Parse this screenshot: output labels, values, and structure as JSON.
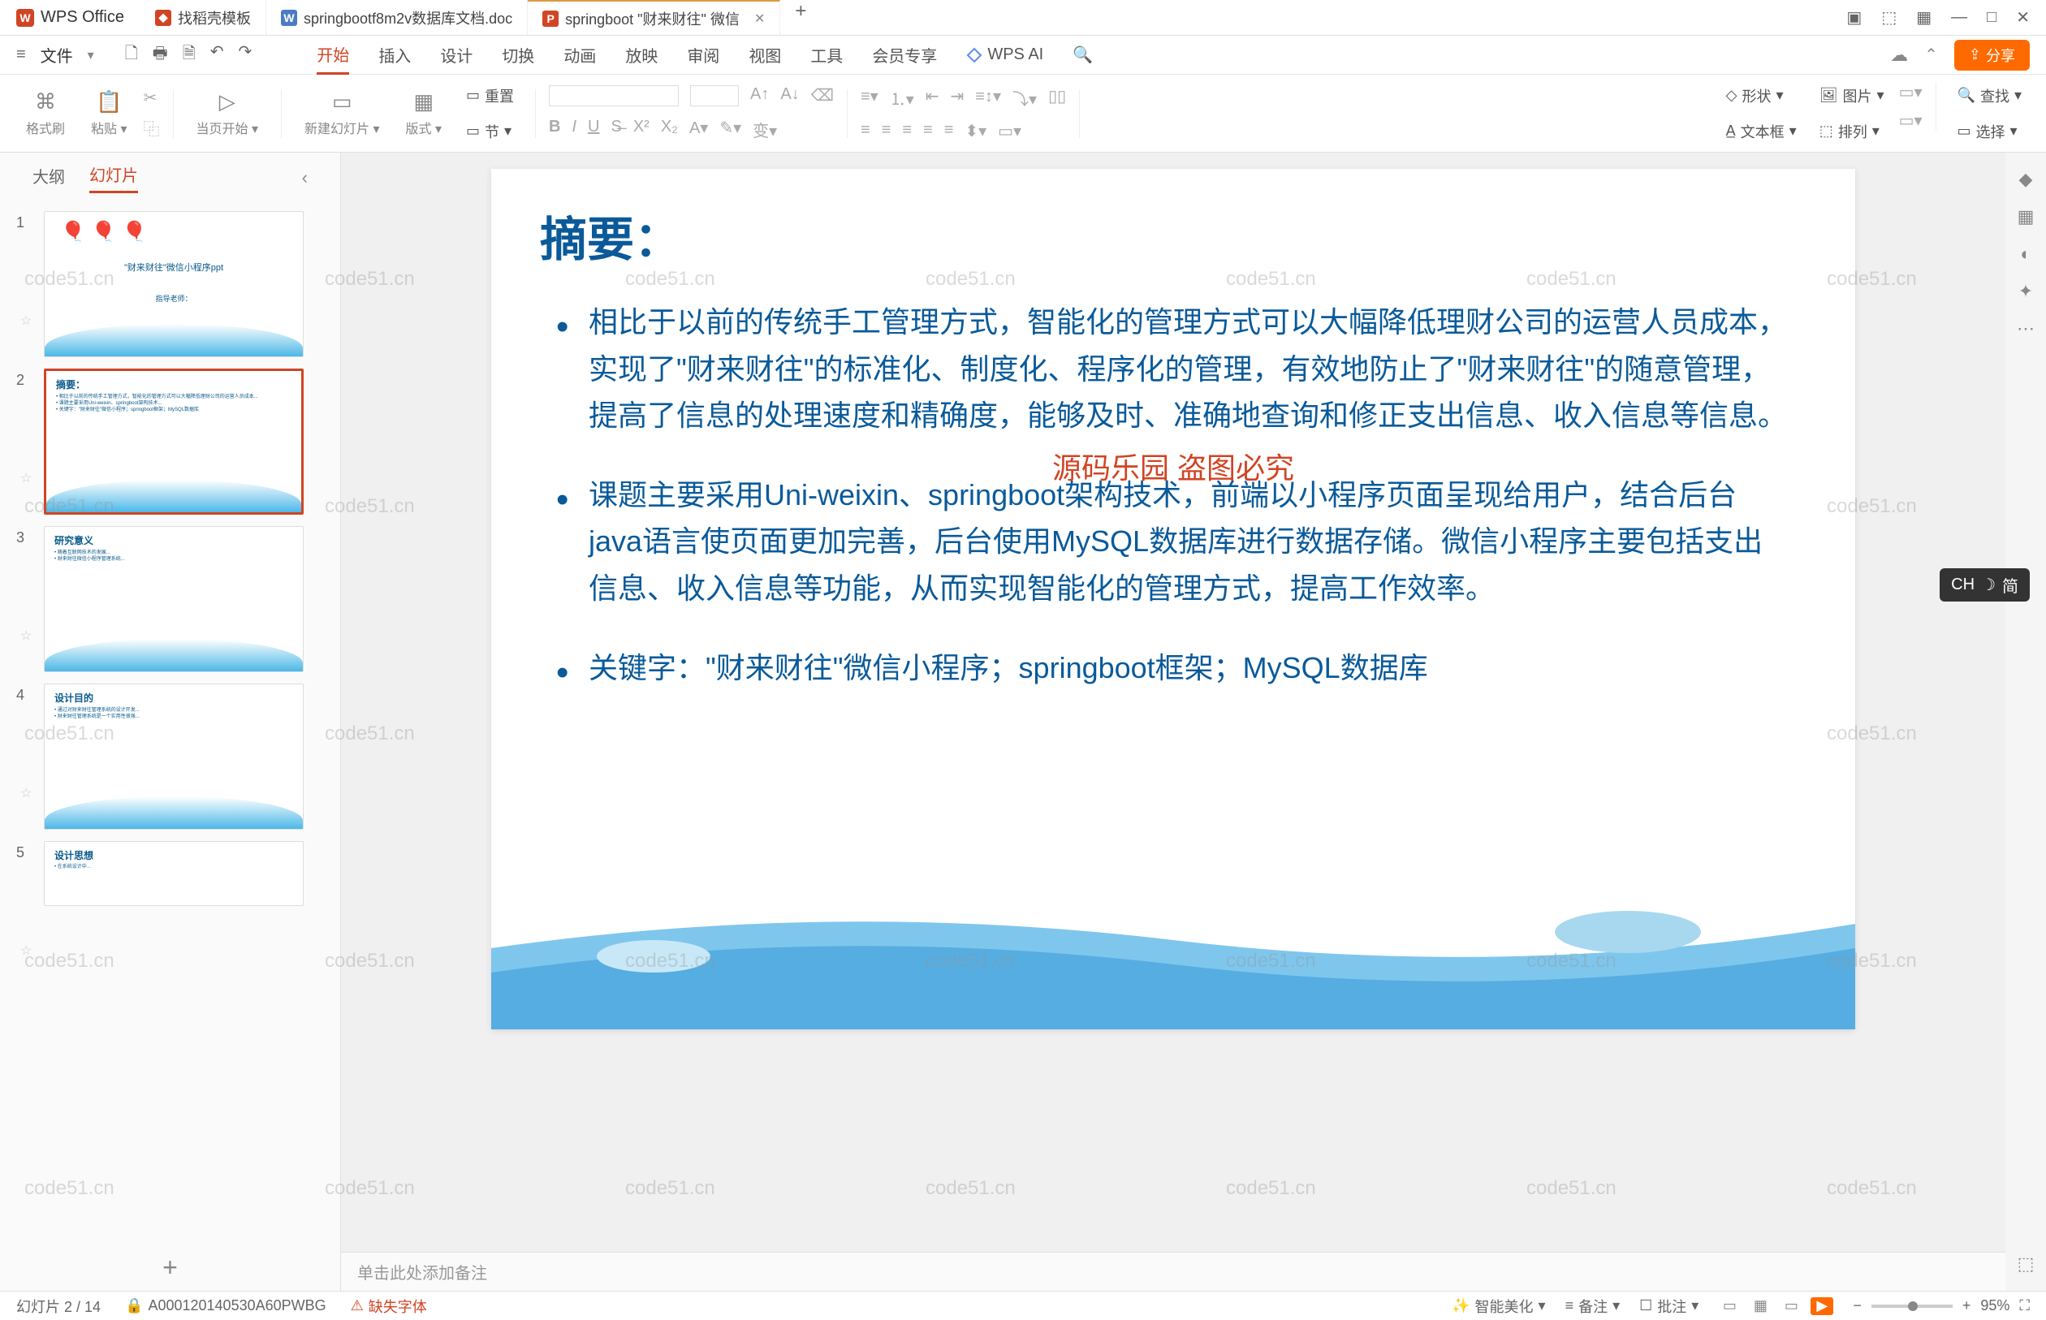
{
  "app": {
    "name": "WPS Office"
  },
  "tabs": [
    {
      "label": "找稻壳模板",
      "icon_bg": "#d14424",
      "icon_text": "D"
    },
    {
      "label": "springbootf8m2v数据库文档.doc",
      "icon_bg": "#4a7cc4",
      "icon_text": "W"
    },
    {
      "label": "springboot \"财来财往\" 微信",
      "icon_bg": "#d14424",
      "icon_text": "P",
      "active": true
    }
  ],
  "menubar": {
    "file": "文件",
    "tabs": [
      "开始",
      "插入",
      "设计",
      "切换",
      "动画",
      "放映",
      "审阅",
      "视图",
      "工具",
      "会员专享"
    ],
    "active_tab": "开始",
    "wps_ai": "WPS AI",
    "share": "分享"
  },
  "ribbon": {
    "format_brush": "格式刷",
    "paste": "粘贴",
    "from_current": "当页开始",
    "new_slide": "新建幻灯片",
    "layout": "版式",
    "section": "节",
    "reset": "重置",
    "shape": "形状",
    "picture": "图片",
    "textbox": "文本框",
    "arrange": "排列",
    "find": "查找",
    "select": "选择"
  },
  "side": {
    "tabs": [
      "大纲",
      "幻灯片"
    ],
    "active": "幻灯片",
    "thumbs": [
      {
        "num": "1",
        "title": "\"财来财往\"微信小程序ppt",
        "sub": "指导老师："
      },
      {
        "num": "2",
        "title": "摘要：",
        "selected": true
      },
      {
        "num": "3",
        "title": "研究意义"
      },
      {
        "num": "4",
        "title": "设计目的"
      },
      {
        "num": "5",
        "title": "设计思想"
      }
    ]
  },
  "slide": {
    "title": "摘要：",
    "bullet1": "相比于以前的传统手工管理方式，智能化的管理方式可以大幅降低理财公司的运营人员成本，实现了\"财来财往\"的标准化、制度化、程序化的管理，有效地防止了\"财来财往\"的随意管理，提高了信息的处理速度和精确度，能够及时、准确地查询和修正支出信息、收入信息等信息。",
    "bullet2": "课题主要采用Uni-weixin、springboot架构技术，前端以小程序页面呈现给用户，结合后台java语言使页面更加完善，后台使用MySQL数据库进行数据存储。微信小程序主要包括支出信息、收入信息等功能，从而实现智能化的管理方式，提高工作效率。",
    "bullet3": "关键字：\"财来财往\"微信小程序；springboot框架；MySQL数据库",
    "overlay": "源码乐园 盗图必究"
  },
  "notes": {
    "placeholder": "单击此处添加备注"
  },
  "status": {
    "slide_pos": "幻灯片 2 / 14",
    "doc_id": "A000120140530A60PWBG",
    "missing_font": "缺失字体",
    "beautify": "智能美化",
    "notes": "备注",
    "review": "批注",
    "zoom": "95%"
  },
  "ime": {
    "label": "CH",
    "mode": "简"
  },
  "watermark": "code51.cn"
}
